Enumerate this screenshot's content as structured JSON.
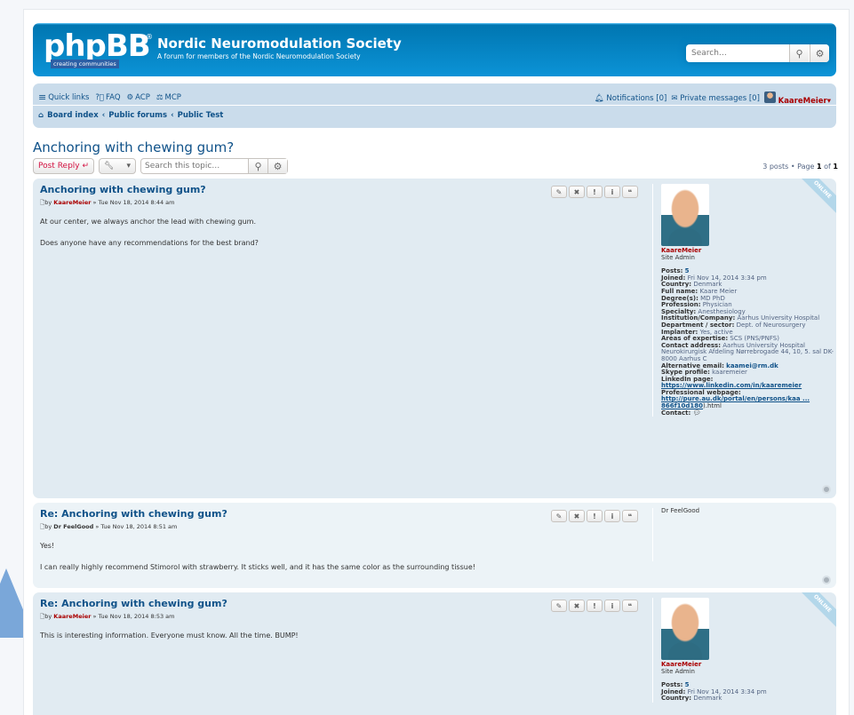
{
  "header": {
    "logo_text": "phpBB",
    "logo_tagline": "creating communities",
    "site_name": "Nordic Neuromodulation Society",
    "site_description": "A forum for members of the Nordic Neuromodulation Society",
    "search_placeholder": "Search…"
  },
  "nav": {
    "quick_links": "Quick links",
    "faq": "FAQ",
    "acp": "ACP",
    "mcp": "MCP",
    "notifications": "Notifications [0]",
    "private_messages": "Private messages [0]",
    "username": "KaareMeier",
    "breadcrumbs": [
      "Board index",
      "Public forums",
      "Public Test"
    ]
  },
  "topic": {
    "title": "Anchoring with chewing gum?",
    "post_reply": "Post Reply",
    "search_placeholder": "Search this topic…",
    "pagination": {
      "posts": "3 posts",
      "page_label": "Page",
      "current": "1",
      "of": "of",
      "total": "1"
    }
  },
  "posts": [
    {
      "title": "Anchoring with chewing gum?",
      "by": "by",
      "author": "KaareMeier",
      "date": "» Tue Nov 18, 2014 8:44 am",
      "paragraphs": [
        "At our center, we always anchor the lead with chewing gum.",
        "Does anyone have any recommendations for the best brand?"
      ],
      "online": "ONLINE"
    },
    {
      "title": "Re: Anchoring with chewing gum?",
      "by": "by",
      "author": "Dr FeelGood",
      "date": "» Tue Nov 18, 2014 8:51 am",
      "paragraphs": [
        "Yes!",
        "I can really highly recommend Stimorol with strawberry. It sticks well, and it has the same color as the surrounding tissue!"
      ]
    },
    {
      "title": "Re: Anchoring with chewing gum?",
      "by": "by",
      "author": "KaareMeier",
      "date": "» Tue Nov 18, 2014 8:53 am",
      "paragraphs": [
        "This is interesting information. Everyone must know. All the time. BUMP!"
      ],
      "online": "ONLINE"
    }
  ],
  "profile": {
    "username": "KaareMeier",
    "rank": "Site Admin",
    "fields": [
      {
        "label": "Posts:",
        "value": "5",
        "link": true
      },
      {
        "label": "Joined:",
        "value": "Fri Nov 14, 2014 3:34 pm"
      },
      {
        "label": "Country:",
        "value": "Denmark"
      },
      {
        "label": "Full name:",
        "value": "Kaare Meier"
      },
      {
        "label": "Degree(s):",
        "value": "MD PhD"
      },
      {
        "label": "Profession:",
        "value": "Physician"
      },
      {
        "label": "Specialty:",
        "value": "Anesthesiology"
      },
      {
        "label": "Institution/Company:",
        "value": "Aarhus University Hospital"
      },
      {
        "label": "Department / sector:",
        "value": "Dept. of Neurosurgery"
      },
      {
        "label": "Implanter:",
        "value": "Yes, active"
      },
      {
        "label": "Areas of expertise:",
        "value": "SCS (PNS/PNFS)"
      },
      {
        "label": "Contact address:",
        "value": "Aarhus University Hospital Neurokirurgisk Afdeling Nørrebrogade 44, 10, 5. sal DK-8000 Aarhus C"
      },
      {
        "label": "Alternative email:",
        "value": "kaamei@rm.dk",
        "link": true
      },
      {
        "label": "Skype profile:",
        "value": "kaaremeier"
      },
      {
        "label": "LinkedIn page:",
        "value": "https://www.linkedin.com/in/kaaremeier",
        "link": true
      },
      {
        "label": "Professional webpage:",
        "value": "http://pure.au.dk/portal/en/persons/kaa ... 866f10d180",
        "link": true,
        "suffix": ").html"
      },
      {
        "label": "Contact:",
        "value": ""
      }
    ]
  },
  "profile2_name": "Dr FeelGood"
}
